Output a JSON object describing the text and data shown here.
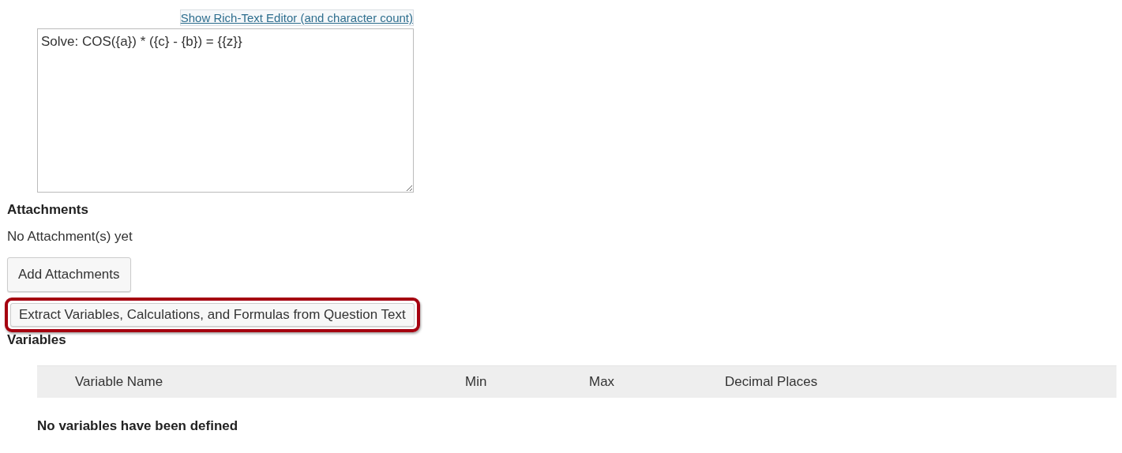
{
  "editor_toggle": {
    "label": "Show Rich-Text Editor (and character count)"
  },
  "question_text": {
    "value": "Solve: COS({a}) * ({c} - {b}) = {{z}}"
  },
  "attachments": {
    "heading": "Attachments",
    "status": "No Attachment(s) yet",
    "button": "Add Attachments"
  },
  "extract_button": {
    "label": "Extract Variables, Calculations, and Formulas from Question Text",
    "highlighted": true
  },
  "variables": {
    "heading": "Variables",
    "columns": [
      "Variable Name",
      "Min",
      "Max",
      "Decimal Places"
    ],
    "empty_message": "No variables have been defined"
  }
}
